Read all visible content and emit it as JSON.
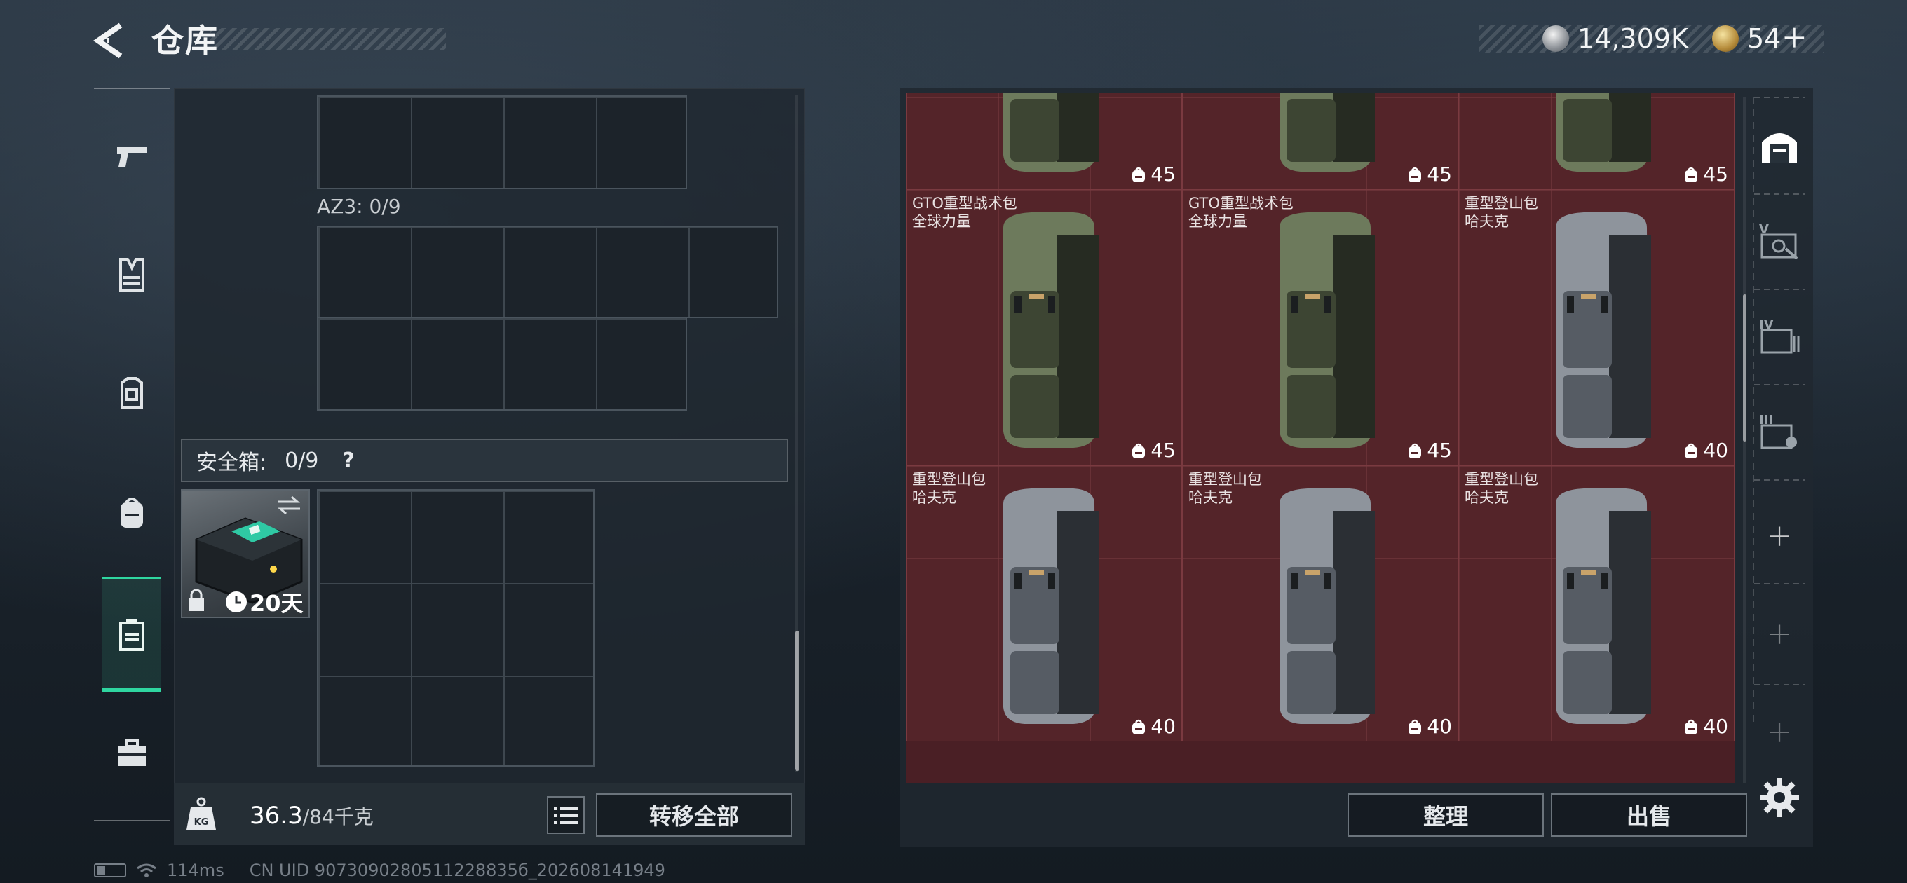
{
  "header": {
    "title": "仓库"
  },
  "currency": {
    "silver": "14,309K",
    "gold": "54＋"
  },
  "left_nav": {
    "items": [
      {
        "name": "weapon"
      },
      {
        "name": "vest"
      },
      {
        "name": "armor"
      },
      {
        "name": "backpack"
      },
      {
        "name": "safe-box",
        "active": true
      },
      {
        "name": "toolbox"
      }
    ]
  },
  "left_panel": {
    "az3_label": "AZ3: 0/9",
    "safe_label": "安全箱:",
    "safe_count": "0/9",
    "safe_help": "?",
    "safe_item_days": "20天",
    "weight_value": "36.3",
    "weight_capacity": "/84千克",
    "transfer_all": "转移全部"
  },
  "stash": {
    "accent_color": "#542429",
    "items": [
      {
        "name_line1": "",
        "name_line2": "",
        "capacity": "45",
        "variant": "green",
        "partial": "top"
      },
      {
        "name_line1": "",
        "name_line2": "",
        "capacity": "45",
        "variant": "green",
        "partial": "top"
      },
      {
        "name_line1": "",
        "name_line2": "",
        "capacity": "45",
        "variant": "green",
        "partial": "top"
      },
      {
        "name_line1": "GTO重型战术包",
        "name_line2": "全球力量",
        "capacity": "45",
        "variant": "green"
      },
      {
        "name_line1": "GTO重型战术包",
        "name_line2": "全球力量",
        "capacity": "45",
        "variant": "green"
      },
      {
        "name_line1": "重型登山包",
        "name_line2": "哈夫克",
        "capacity": "40",
        "variant": "gray"
      },
      {
        "name_line1": "重型登山包",
        "name_line2": "哈夫克",
        "capacity": "40",
        "variant": "gray",
        "partial": "bottom"
      },
      {
        "name_line1": "重型登山包",
        "name_line2": "哈夫克",
        "capacity": "40",
        "variant": "gray",
        "partial": "bottom"
      },
      {
        "name_line1": "重型登山包",
        "name_line2": "哈夫克",
        "capacity": "40",
        "variant": "gray",
        "partial": "bottom"
      }
    ]
  },
  "actions": {
    "organize": "整理",
    "sell": "出售"
  },
  "right_tabs": [
    {
      "name": "stash-home",
      "active": true
    },
    {
      "name": "tier-v"
    },
    {
      "name": "tier-iv"
    },
    {
      "name": "tier-iii"
    },
    {
      "name": "add"
    },
    {
      "name": "add"
    },
    {
      "name": "add"
    }
  ],
  "status": {
    "ping": "114ms",
    "uid": "CN UID 9073090280511228835б_202608141949"
  }
}
